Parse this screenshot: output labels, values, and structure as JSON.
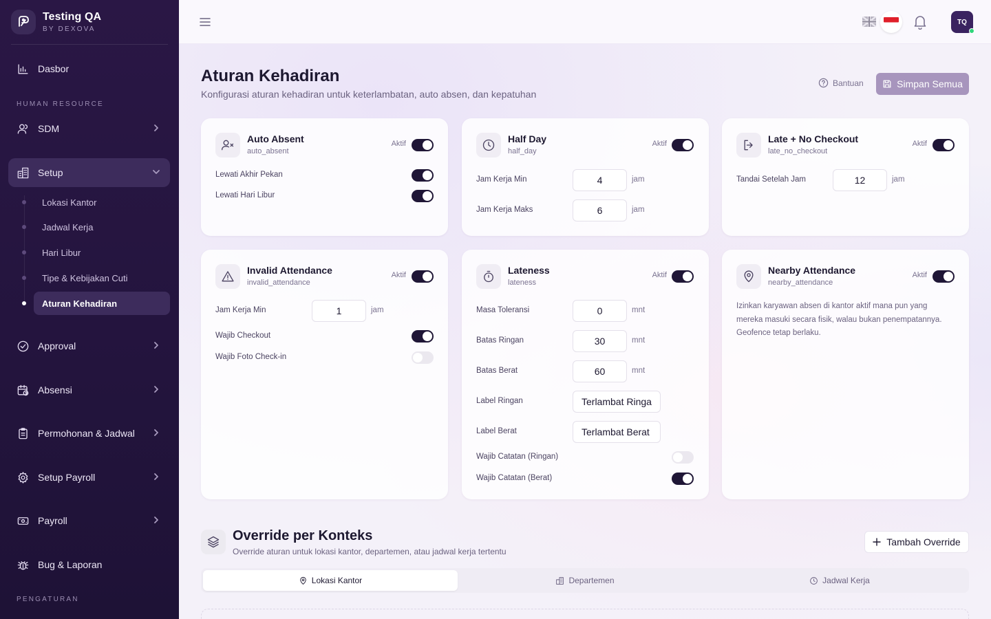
{
  "brand": {
    "title": "Testing QA",
    "subtitle": "BY DEXOVA"
  },
  "sidebar": {
    "dashboard": "Dasbor",
    "section_hr": "HUMAN RESOURCE",
    "sdm": "SDM",
    "setup": "Setup",
    "setup_children": [
      "Lokasi Kantor",
      "Jadwal Kerja",
      "Hari Libur",
      "Tipe & Kebijakan Cuti",
      "Aturan Kehadiran"
    ],
    "approval": "Approval",
    "absensi": "Absensi",
    "permohonan": "Permohonan & Jadwal",
    "setup_payroll": "Setup Payroll",
    "payroll": "Payroll",
    "bug": "Bug & Laporan",
    "section_settings": "PENGATURAN"
  },
  "header": {
    "avatar": "TQ"
  },
  "page": {
    "title": "Aturan Kehadiran",
    "subtitle": "Konfigurasi aturan kehadiran untuk keterlambatan, auto absen, dan kepatuhan",
    "help": "Bantuan",
    "save": "Simpan Semua"
  },
  "cards": {
    "aktif": "Aktif",
    "auto_absent": {
      "title": "Auto Absent",
      "key": "auto_absent",
      "active": true,
      "skip_weekend": "Lewati Akhir Pekan",
      "skip_weekend_on": true,
      "skip_holiday": "Lewati Hari Libur",
      "skip_holiday_on": true
    },
    "half_day": {
      "title": "Half Day",
      "key": "half_day",
      "active": true,
      "min_label": "Jam Kerja Min",
      "min_value": "4",
      "max_label": "Jam Kerja Maks",
      "max_value": "6",
      "unit": "jam"
    },
    "late_no_checkout": {
      "title": "Late + No Checkout",
      "key": "late_no_checkout",
      "active": true,
      "after_label": "Tandai Setelah Jam",
      "after_value": "12",
      "unit": "jam"
    },
    "invalid_attendance": {
      "title": "Invalid Attendance",
      "key": "invalid_attendance",
      "active": true,
      "min_label": "Jam Kerja Min",
      "min_value": "1",
      "unit": "jam",
      "checkout_label": "Wajib Checkout",
      "checkout_on": true,
      "photo_label": "Wajib Foto Check-in",
      "photo_on": false
    },
    "lateness": {
      "title": "Lateness",
      "key": "lateness",
      "active": true,
      "tolerance_label": "Masa Toleransi",
      "tolerance_value": "0",
      "light_label": "Batas Ringan",
      "light_value": "30",
      "heavy_label": "Batas Berat",
      "heavy_value": "60",
      "unit": "mnt",
      "light_name_label": "Label Ringan",
      "light_name_value": "Terlambat Ringa",
      "heavy_name_label": "Label Berat",
      "heavy_name_value": "Terlambat Berat",
      "note_light_label": "Wajib Catatan (Ringan)",
      "note_light_on": false,
      "note_heavy_label": "Wajib Catatan (Berat)",
      "note_heavy_on": true
    },
    "nearby_attendance": {
      "title": "Nearby Attendance",
      "key": "nearby_attendance",
      "active": true,
      "description": "Izinkan karyawan absen di kantor aktif mana pun yang mereka masuki secara fisik, walau bukan penempatannya. Geofence tetap berlaku."
    }
  },
  "override": {
    "title": "Override per Konteks",
    "subtitle": "Override aturan untuk lokasi kantor, departemen, atau jadwal kerja tertentu",
    "add": "Tambah Override",
    "tabs": [
      "Lokasi Kantor",
      "Departemen",
      "Jadwal Kerja"
    ],
    "active_tab": "Lokasi Kantor"
  }
}
